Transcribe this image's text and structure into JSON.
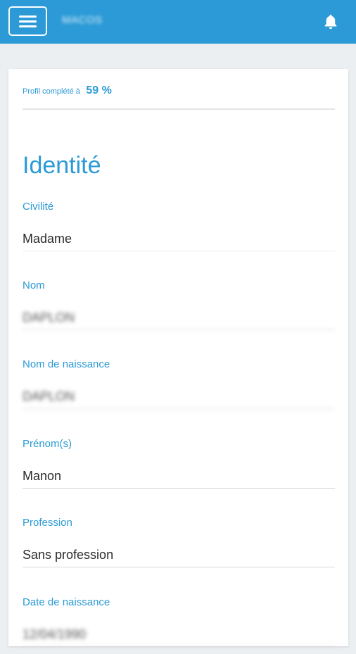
{
  "header": {
    "app_title": "MACOS",
    "menu_icon": "hamburger-menu-icon",
    "notification_icon": "bell-icon",
    "bar_color": "#2b9ad6"
  },
  "profile": {
    "completion_label": "Profil complété à",
    "completion_value": "59 %",
    "completion_percent": 59
  },
  "identity": {
    "section_title": "Identité",
    "fields": [
      {
        "label": "Civilité",
        "value": "Madame"
      },
      {
        "label": "Nom",
        "value": "DAPLON"
      },
      {
        "label": "Nom de naissance",
        "value": "DAPLON"
      },
      {
        "label": "Prénom(s)",
        "value": "Manon"
      },
      {
        "label": "Profession",
        "value": "Sans profession"
      },
      {
        "label": "Date de naissance",
        "value": "12/04/1990"
      }
    ]
  },
  "accent_color": "#2b9ad6"
}
